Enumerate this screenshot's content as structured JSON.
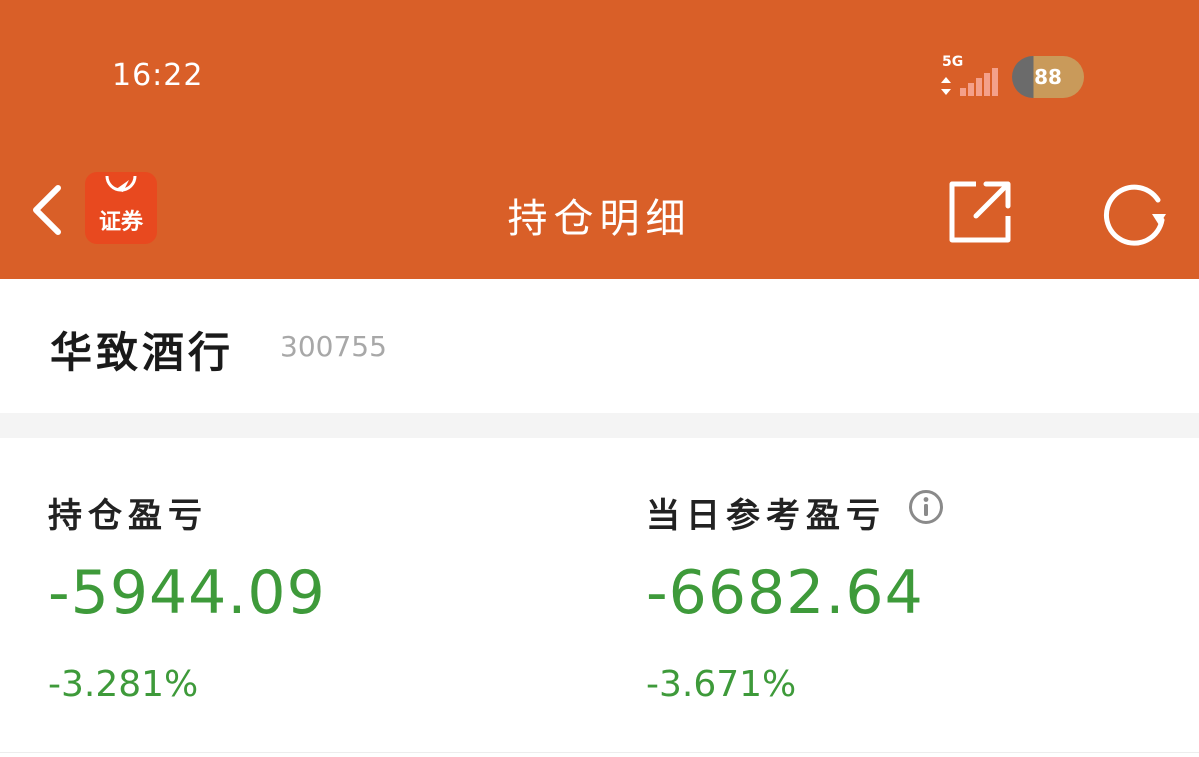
{
  "status_bar": {
    "time": "16:22",
    "network": "5G",
    "battery": "88"
  },
  "nav": {
    "title": "持仓明细",
    "app_logo_text": "证券"
  },
  "stock": {
    "name": "华致酒行",
    "code": "300755"
  },
  "holding_pl": {
    "label": "持仓盈亏",
    "value": "-5944.09",
    "percent": "-3.281%"
  },
  "daily_pl": {
    "label": "当日参考盈亏",
    "value": "-6682.64",
    "percent": "-3.671%"
  },
  "colors": {
    "header_bg": "#D95F28",
    "loss_green": "#3E9A3A",
    "logo_red": "#E8491F"
  },
  "icons": [
    "back-arrow-icon",
    "share-icon",
    "refresh-icon",
    "info-icon",
    "signal-icon",
    "battery-icon"
  ]
}
